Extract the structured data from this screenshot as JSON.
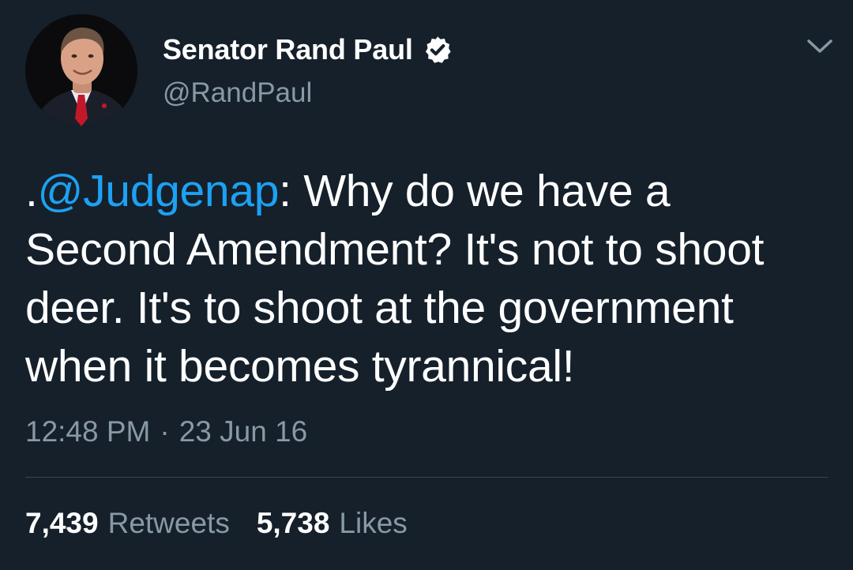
{
  "author": {
    "display_name": "Senator Rand Paul",
    "handle": "@RandPaul",
    "verified": true
  },
  "tweet": {
    "prefix": ".",
    "mention": "@Judgenap",
    "text_after_mention": ": Why do we have a Second Amendment? It's not to shoot deer. It's to shoot at the government when it becomes tyrannical!",
    "time": "12:48 PM",
    "separator": "·",
    "date": "23 Jun 16"
  },
  "stats": {
    "retweets_count": "7,439",
    "retweets_label": "Retweets",
    "likes_count": "5,738",
    "likes_label": "Likes"
  },
  "icons": {
    "verified": "verified-badge-icon",
    "chevron": "chevron-down-icon"
  },
  "colors": {
    "background": "#15202b",
    "mention": "#1da1f2",
    "secondary_text": "#8899a6",
    "divider": "#38444d"
  }
}
